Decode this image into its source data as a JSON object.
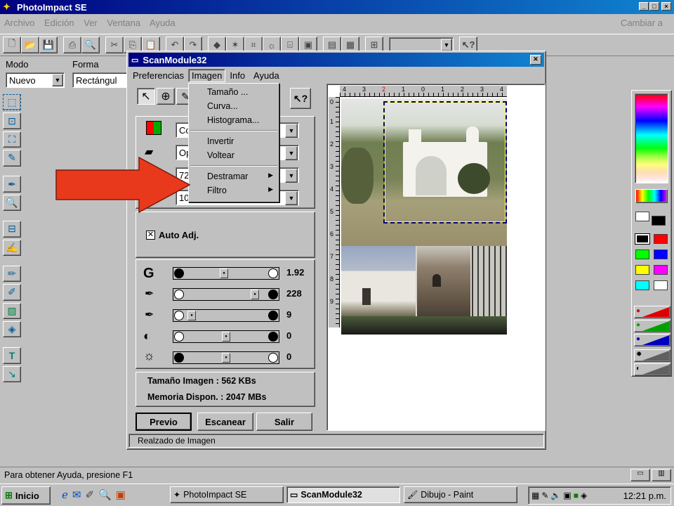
{
  "app": {
    "title": "PhotoImpact SE",
    "cambiar": "Cambiar a"
  },
  "menubar": [
    "Archivo",
    "Edición",
    "Ver",
    "Ventana",
    "Ayuda"
  ],
  "optionbar": {
    "modo_label": "Modo",
    "modo_value": "Nuevo",
    "forma_label": "Forma",
    "forma_value": "Rectángul"
  },
  "dialog": {
    "title": "ScanModule32",
    "menu": [
      "Preferencias",
      "Imagen",
      "Info",
      "Ayuda"
    ],
    "dropdowns": [
      "Co",
      "Op",
      "72",
      "10"
    ],
    "auto_adj": "Auto Adj.",
    "sliders": [
      {
        "name": "gamma",
        "icon": "G",
        "value": "1.92"
      },
      {
        "name": "highlight",
        "icon": "highlight",
        "value": "228"
      },
      {
        "name": "shadow",
        "icon": "shadow",
        "value": "9"
      },
      {
        "name": "contrast",
        "icon": "contrast",
        "value": "0"
      },
      {
        "name": "brightness",
        "icon": "brightness",
        "value": "0"
      }
    ],
    "image_size": "Tamaño Imagen : 562 KBs",
    "memory": "Memoria Dispon. : 2047 MBs",
    "buttons": {
      "preview": "Previo",
      "scan": "Escanear",
      "exit": "Salir"
    },
    "status": "Realzado de Imagen",
    "ruler_h": [
      "4",
      "3",
      "2",
      "1",
      "0",
      "1",
      "2",
      "3",
      "4"
    ],
    "ruler_v": [
      "0",
      "1",
      "2",
      "3",
      "4",
      "5",
      "6",
      "7",
      "8",
      "9"
    ]
  },
  "imagen_menu": {
    "items": [
      {
        "label": "Tamaño ...",
        "submenu": false
      },
      {
        "label": "Curva...",
        "submenu": false
      },
      {
        "label": "Histograma...",
        "submenu": false
      },
      {
        "sep": true
      },
      {
        "label": "Invertir",
        "submenu": false
      },
      {
        "label": "Voltear",
        "submenu": false
      },
      {
        "sep": true
      },
      {
        "label": "Destramar",
        "submenu": true
      },
      {
        "label": "Filtro",
        "submenu": true
      }
    ]
  },
  "statusbar": {
    "help": "Para obtener Ayuda, presione F1"
  },
  "taskbar": {
    "start": "Inicio",
    "tasks": [
      {
        "label": "PhotoImpact SE",
        "active": false
      },
      {
        "label": "ScanModule32",
        "active": true
      },
      {
        "label": "Dibujo - Paint",
        "active": false
      }
    ],
    "clock": "12:21 p.m."
  },
  "colors": {
    "title": "#000080",
    "arrow": "#e8391c",
    "selection": "#000080",
    "accent": "#ffff00"
  }
}
